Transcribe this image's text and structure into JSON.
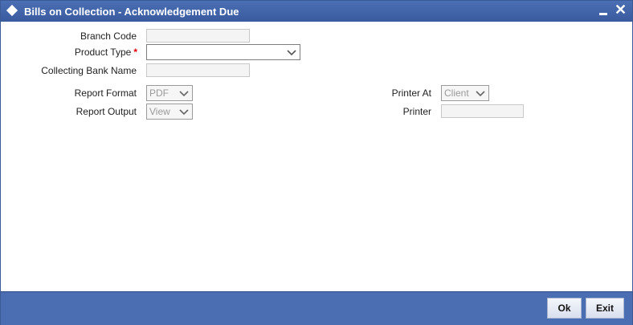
{
  "window": {
    "title": "Bills on Collection - Acknowledgement Due"
  },
  "form": {
    "branch_code_label": "Branch Code",
    "branch_code_value": "",
    "product_type_label": "Product Type",
    "product_type_required": "*",
    "product_type_value": "",
    "collecting_bank_label": "Collecting Bank Name",
    "collecting_bank_value": "",
    "report_format_label": "Report Format",
    "report_format_value": "PDF",
    "report_output_label": "Report Output",
    "report_output_value": "View",
    "printer_at_label": "Printer At",
    "printer_at_value": "Client",
    "printer_label": "Printer",
    "printer_value": ""
  },
  "footer": {
    "ok_label": "Ok",
    "exit_label": "Exit"
  },
  "colors": {
    "titlebar": "#3f62a8",
    "footer": "#4b6eb2",
    "required": "#dd0000"
  }
}
